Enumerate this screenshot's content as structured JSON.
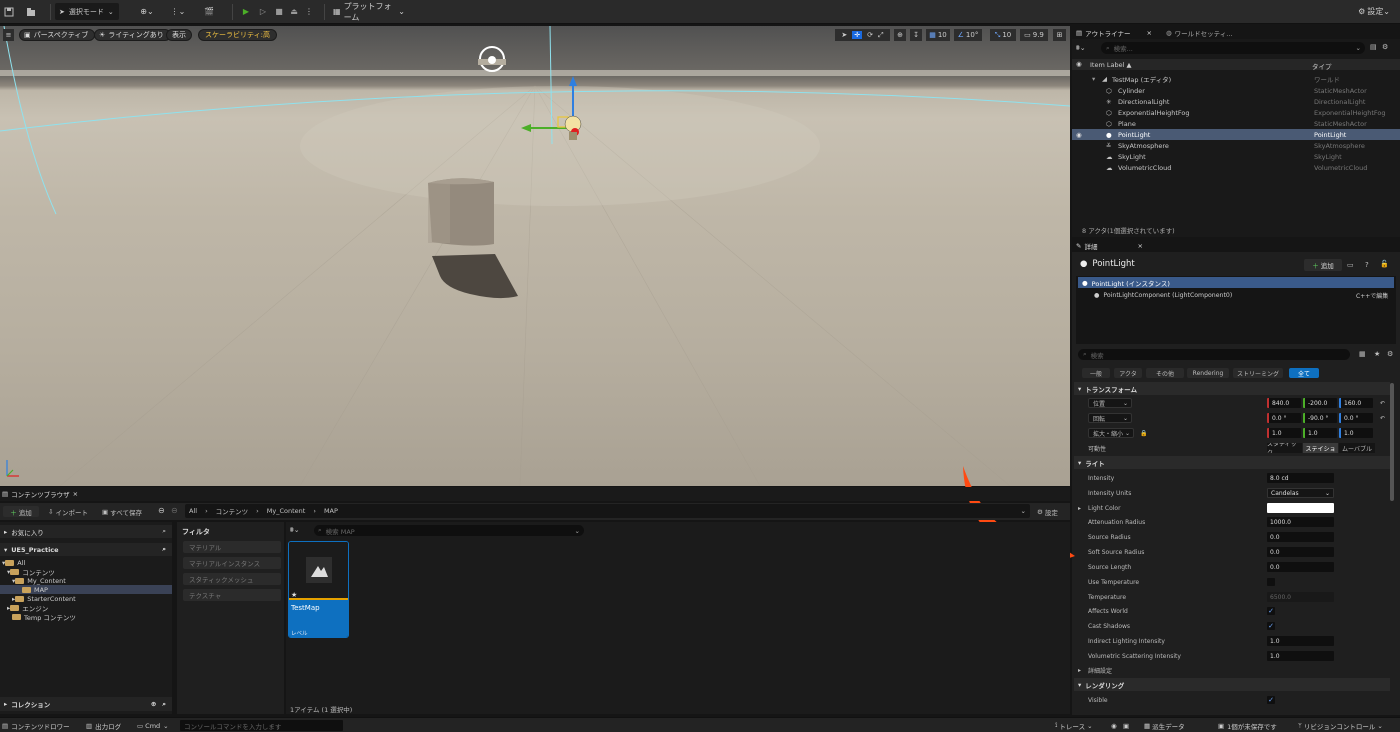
{
  "toolbar": {
    "select_mode": "選択モード",
    "platform": "プラットフォーム",
    "settings": "設定"
  },
  "viewport": {
    "perspective": "パースペクティブ",
    "lighting": "ライティングあり",
    "show": "表示",
    "scalability": "スケーラビリティ:高",
    "grid_snap": "10",
    "rot_snap": "10°",
    "scale_snap": "10",
    "cam_speed": "9.9"
  },
  "outliner": {
    "tab_outliner": "アウトライナー",
    "tab_world": "ワールドセッティ...",
    "search_placeholder": "検索...",
    "col_label": "Item Label ▲",
    "col_type": "タイプ",
    "root_label": "TestMap (エディタ)",
    "root_type": "ワールド",
    "items": [
      {
        "label": "Cylinder",
        "type": "StaticMeshActor"
      },
      {
        "label": "DirectionalLight",
        "type": "DirectionalLight"
      },
      {
        "label": "ExponentialHeightFog",
        "type": "ExponentialHeightFog"
      },
      {
        "label": "Plane",
        "type": "StaticMeshActor"
      },
      {
        "label": "PointLight",
        "type": "PointLight"
      },
      {
        "label": "SkyAtmosphere",
        "type": "SkyAtmosphere"
      },
      {
        "label": "SkyLight",
        "type": "SkyLight"
      },
      {
        "label": "VolumetricCloud",
        "type": "VolumetricCloud"
      }
    ],
    "footer": "8 アクタ(1個選択されています)"
  },
  "details": {
    "tab": "詳細",
    "actor_name": "PointLight",
    "add_label": "追加",
    "instance": "PointLight (インスタンス)",
    "component": "PointLightComponent (LightComponent0)",
    "edit_cpp": "C++で編集",
    "search_placeholder": "検索",
    "tabs": [
      "一般",
      "アクタ",
      "その他",
      "Rendering",
      "ストリーミング",
      "全て"
    ],
    "transform_header": "トランスフォーム",
    "location_label": "位置",
    "location": [
      "840.0",
      "-200.0",
      "160.0"
    ],
    "rotation_label": "回転",
    "rotation": [
      "0.0 °",
      "-90.0 °",
      "0.0 °"
    ],
    "scale_label": "拡大・縮小",
    "scale": [
      "1.0",
      "1.0",
      "1.0"
    ],
    "mobility_label": "可動性",
    "mobility": [
      "スタティック",
      "ステイショ",
      "ムーバブル"
    ],
    "light_header": "ライト",
    "intensity_label": "Intensity",
    "intensity": "8.0 cd",
    "intensity_units_label": "Intensity Units",
    "intensity_units": "Candelas",
    "light_color_label": "Light Color",
    "attenuation_label": "Attenuation Radius",
    "attenuation": "1000.0",
    "source_radius_label": "Source Radius",
    "source_radius": "0.0",
    "soft_source_radius_label": "Soft Source Radius",
    "soft_source_radius": "0.0",
    "source_length_label": "Source Length",
    "source_length": "0.0",
    "use_temperature_label": "Use Temperature",
    "temperature_label": "Temperature",
    "temperature": "6500.0",
    "affects_world_label": "Affects World",
    "cast_shadows_label": "Cast Shadows",
    "indirect_label": "Indirect Lighting Intensity",
    "indirect": "1.0",
    "volumetric_label": "Volumetric Scattering Intensity",
    "volumetric": "1.0",
    "advanced_label": "詳細設定",
    "rendering_header": "レンダリング",
    "visible_label": "Visible",
    "colors": {
      "accent": "#0e70c0",
      "selection": "#4a5a74",
      "arrow": "#ff4a12",
      "gizmo_x": "#4caf28",
      "gizmo_z": "#2f7fe0"
    }
  },
  "content_browser": {
    "tab": "コンテンツブラウザ",
    "add": "追加",
    "import": "インポート",
    "save_all": "すべて保存",
    "breadcrumb": [
      "All",
      "コンテンツ",
      "My_Content",
      "MAP"
    ],
    "settings": "設定",
    "favorites": "お気に入り",
    "project": "UE5_Practice",
    "tree": [
      "All",
      "コンテンツ",
      "My_Content",
      "MAP",
      "StarterContent",
      "エンジン",
      "Temp コンテンツ"
    ],
    "collections": "コレクション",
    "filters_title": "フィルタ",
    "filters": [
      "マテリアル",
      "マテリアルインスタンス",
      "スタティックメッシュ",
      "テクスチャ"
    ],
    "search_placeholder": "検索 MAP",
    "asset_name": "TestMap",
    "asset_type": "レベル",
    "item_count": "1アイテム (1 選択中)"
  },
  "statusbar": {
    "drawer": "コンテンツドロワー",
    "output_log": "出力ログ",
    "cmd": "Cmd",
    "console_placeholder": "コンソールコマンドを入力します",
    "trace": "トレース",
    "derived": "派生データ",
    "unsaved": "1個が未保存です",
    "source_control": "リビジョンコントロール"
  }
}
